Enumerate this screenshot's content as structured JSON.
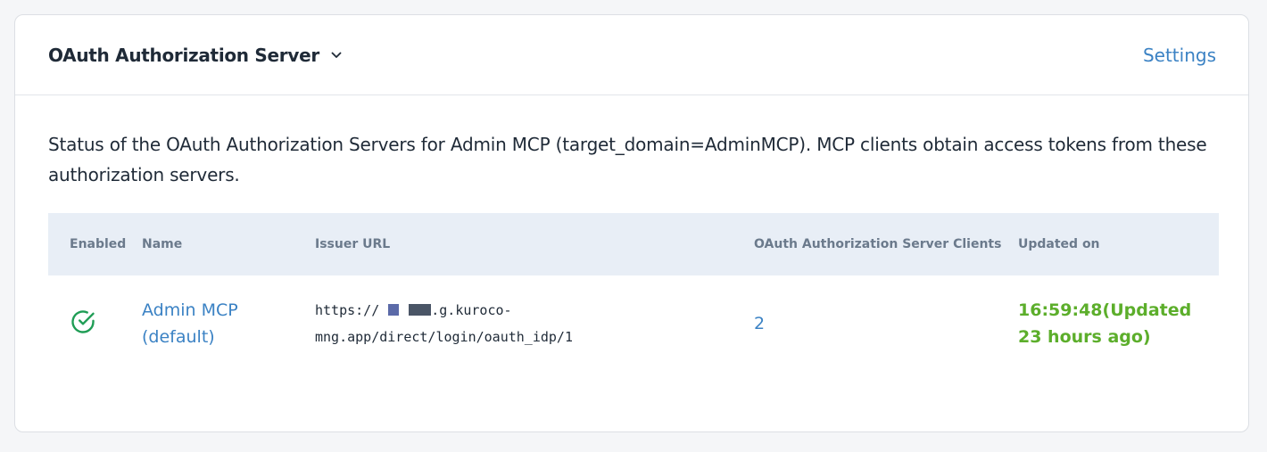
{
  "header": {
    "title": "OAuth Authorization Server",
    "settings_label": "Settings"
  },
  "description": "Status of the OAuth Authorization Servers for Admin MCP (target_domain=AdminMCP). MCP clients obtain access tokens from these authorization servers.",
  "table": {
    "columns": {
      "enabled": "Enabled",
      "name": "Name",
      "issuer_url": "Issuer URL",
      "clients": "OAuth Authorization Server Clients",
      "updated_on": "Updated on"
    },
    "rows": [
      {
        "enabled_icon": "check-circle-icon",
        "name": "Admin MCP (default)",
        "issuer_url_prefix": "https://",
        "issuer_url_suffix": ".g.kuroco-mng.app/direct/login/oauth_idp/1",
        "clients": "2",
        "updated_on": "16:59:48(Updated 23 hours ago)"
      }
    ]
  },
  "colors": {
    "accent": "#3b82c4",
    "success": "#1f9d55",
    "updated": "#5cae2b",
    "table_header_bg": "#e8eef6"
  }
}
